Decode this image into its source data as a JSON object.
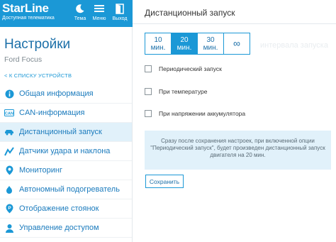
{
  "header": {
    "brand": "StarLine",
    "brand_sub": "Доступная телематика",
    "buttons": [
      {
        "label": "Темa",
        "icon": "moon-icon"
      },
      {
        "label": "Меню",
        "icon": "menu-icon"
      },
      {
        "label": "Выход",
        "icon": "exit-door-icon"
      }
    ]
  },
  "sidebar": {
    "title": "Настройки",
    "subtitle": "Ford Focus",
    "back_link": "< К СПИСКУ УСТРОЙСТВ",
    "items": [
      {
        "label": "Общая информация",
        "icon": "info-icon"
      },
      {
        "label": "CAN-информация",
        "icon": "can-icon"
      },
      {
        "label": "Дистанционный запуск",
        "icon": "car-icon",
        "active": true
      },
      {
        "label": "Датчики удара и наклона",
        "icon": "shock-sensor-icon"
      },
      {
        "label": "Мониторинг",
        "icon": "location-pin-icon"
      },
      {
        "label": "Автономный подогреватель",
        "icon": "heater-icon"
      },
      {
        "label": "Отображение стоянок",
        "icon": "parking-icon"
      },
      {
        "label": "Управление доступом",
        "icon": "user-access-icon"
      }
    ]
  },
  "main": {
    "title": "Дистанционный запуск",
    "durations": [
      {
        "value": "10",
        "unit": "мин."
      },
      {
        "value": "20",
        "unit": "мин.",
        "selected": true
      },
      {
        "value": "30",
        "unit": "мин."
      },
      {
        "value": "∞",
        "unit": ""
      }
    ],
    "ghost_text": "интервала запуска",
    "options": [
      {
        "label": "Периодический запуск",
        "checked": false
      },
      {
        "label": "При температуре",
        "checked": false
      },
      {
        "label": "При напряжении аккумулятора",
        "checked": false
      }
    ],
    "info_text": "Сразу после сохранения настроек, при включенной опции \"Периодический запуск\", будет произведен дистанционный запуск двигателя на 20 мин.",
    "save_label": "Сохранить"
  },
  "colors": {
    "accent": "#1b98d6",
    "active_bg": "#e1f1fa",
    "link": "#1b7bbd"
  }
}
